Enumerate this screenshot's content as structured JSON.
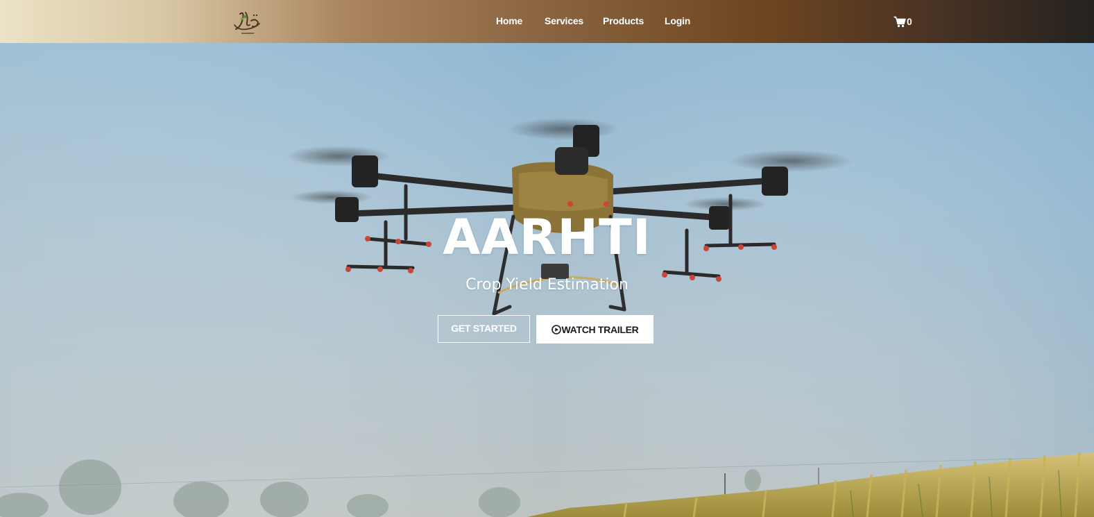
{
  "brand": {
    "logo_icon": "aarhti-calligraphy-logo-icon",
    "logo_text": "آڑھتی"
  },
  "nav": {
    "items": [
      {
        "label": "Home"
      },
      {
        "label": "Services"
      },
      {
        "label": "Products"
      },
      {
        "label": "Login"
      }
    ],
    "cart_icon": "shopping-cart-icon",
    "cart_count": "0"
  },
  "hero": {
    "title": "AARHTI",
    "subtitle": "Crop Yield Estimation",
    "primary_button": "GET STARTED",
    "secondary_button": "WATCH TRAILER",
    "secondary_button_icon": "play-circle-icon",
    "background_image": "agricultural-spray-drone-over-wheat-field"
  },
  "colors": {
    "nav_gradient_start": "#ece2c6",
    "nav_gradient_mid": "#8a6440",
    "nav_gradient_end": "#242220",
    "sky_top": "#8fb7d2",
    "sky_bottom": "#b9c4c7",
    "field": "#c7b25c"
  }
}
